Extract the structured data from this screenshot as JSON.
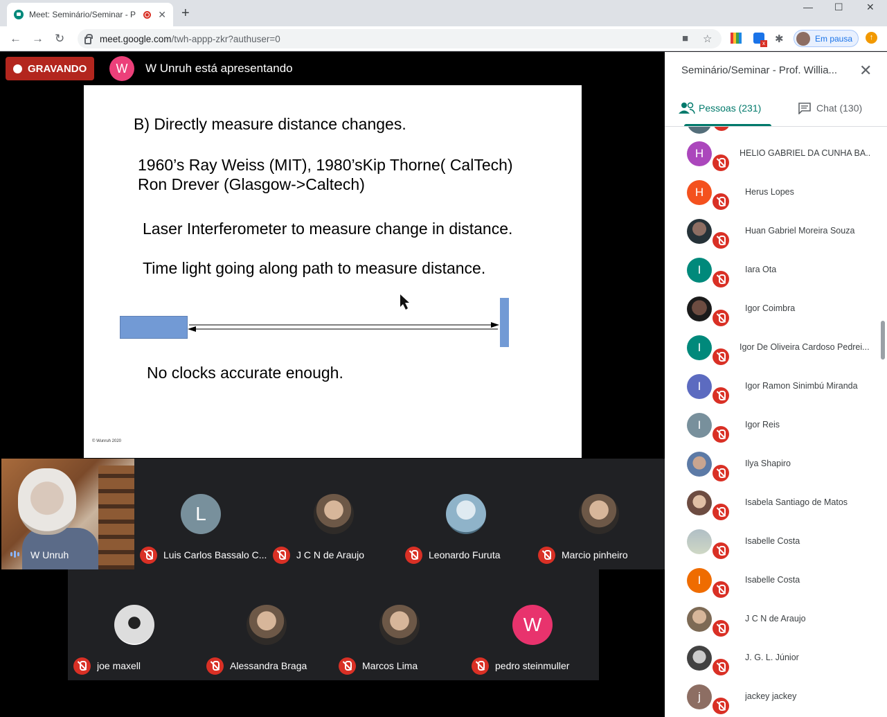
{
  "browser": {
    "tab_title": "Meet: Seminário/Seminar - P",
    "url_host": "meet.google.com",
    "url_path": "/twh-appp-zkr?authuser=0",
    "profile_label": "Em pausa"
  },
  "meet": {
    "recording_label": "GRAVANDO",
    "presenter_initial": "W",
    "presenter_text": "W Unruh está apresentando",
    "colors": {
      "recording": "#b3261e",
      "accent": "#00796b",
      "mic_off": "#d93025"
    }
  },
  "slide": {
    "line1": "B) Directly measure distance changes.",
    "line2": "1960’s Ray Weiss (MIT), 1980’sKip Thorne( CalTech)",
    "line3": "Ron Drever (Glasgow->Caltech)",
    "line4": "Laser Interferometer to measure change in distance.",
    "line5": "Time light going along path to measure distance.",
    "line6": "No clocks accurate enough.",
    "copyright": "© Wunruh 2020"
  },
  "tiles": {
    "self": {
      "name": "W Unruh"
    },
    "row1": [
      {
        "name": "Luis Carlos Bassalo C...",
        "initial": "L",
        "color": "#78909c"
      },
      {
        "name": "J C N de Araujo",
        "initial": "",
        "color": "#7d6a55"
      },
      {
        "name": "Leonardo Furuta",
        "initial": "",
        "color": "#8fb3c9"
      },
      {
        "name": "Marcio pinheiro",
        "initial": "",
        "color": "#a0826d"
      }
    ],
    "row2": [
      {
        "name": "joe maxell",
        "initial": "",
        "color": "#eeeeee"
      },
      {
        "name": "Alessandra Braga",
        "initial": "",
        "color": "#6d4c41"
      },
      {
        "name": "Marcos Lima",
        "initial": "",
        "color": "#5d6d7e"
      },
      {
        "name": "pedro steinmuller",
        "initial": "W",
        "color": "#e8336d"
      }
    ]
  },
  "panel": {
    "title": "Seminário/Seminar - Prof. Willia...",
    "people_tab": "Pessoas (231)",
    "chat_tab": "Chat (130)",
    "people": [
      {
        "name": "HELIO GABRIEL DA CUNHA BA...",
        "initial": "H",
        "color": "#ab47bc"
      },
      {
        "name": "Herus Lopes",
        "initial": "H",
        "color": "#f4511e"
      },
      {
        "name": "Huan Gabriel Moreira Souza",
        "initial": "",
        "color": "#37474f"
      },
      {
        "name": "Iara Ota",
        "initial": "I",
        "color": "#00897b"
      },
      {
        "name": "Igor Coimbra",
        "initial": "",
        "color": "#4e342e"
      },
      {
        "name": "Igor De Oliveira Cardoso Pedrei...",
        "initial": "I",
        "color": "#00897b"
      },
      {
        "name": "Igor Ramon Sinimbú Miranda",
        "initial": "I",
        "color": "#5c6bc0"
      },
      {
        "name": "Igor Reis",
        "initial": "I",
        "color": "#78909c"
      },
      {
        "name": "Ilya Shapiro",
        "initial": "",
        "color": "#90a4ae"
      },
      {
        "name": "Isabela Santiago de Matos",
        "initial": "",
        "color": "#a1887f"
      },
      {
        "name": "Isabelle Costa",
        "initial": "",
        "color": "#b0bec5"
      },
      {
        "name": "Isabelle Costa",
        "initial": "I",
        "color": "#ef6c00"
      },
      {
        "name": "J C N de Araujo",
        "initial": "",
        "color": "#7d6a55"
      },
      {
        "name": "J. G. L. Júnior",
        "initial": "",
        "color": "#9e9e9e"
      },
      {
        "name": "jackey jackey",
        "initial": "j",
        "color": "#8d6e63"
      }
    ]
  }
}
